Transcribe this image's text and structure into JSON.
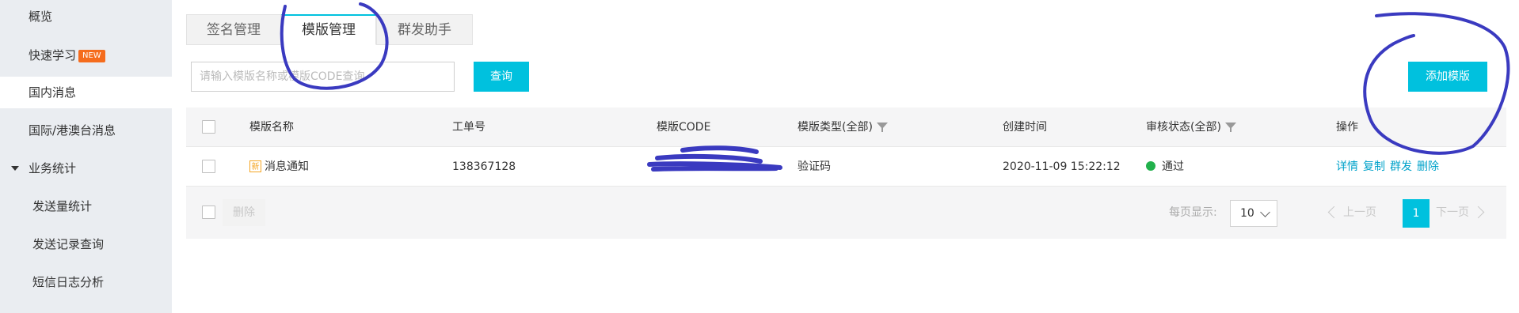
{
  "sidebar": {
    "items": [
      {
        "label": "概览"
      },
      {
        "label": "快速学习",
        "badge": "NEW"
      },
      {
        "label": "国内消息",
        "active": true
      },
      {
        "label": "国际/港澳台消息"
      },
      {
        "label": "业务统计",
        "expanded": true
      },
      {
        "label": "发送量统计"
      },
      {
        "label": "发送记录查询"
      },
      {
        "label": "短信日志分析"
      }
    ]
  },
  "tabs": [
    {
      "label": "签名管理"
    },
    {
      "label": "模版管理",
      "active": true
    },
    {
      "label": "群发助手"
    }
  ],
  "search": {
    "placeholder": "请输入模版名称或模版CODE查询",
    "query_label": "查询"
  },
  "add_template_label": "添加模版",
  "table": {
    "headers": {
      "name": "模版名称",
      "order_no": "工单号",
      "code": "模版CODE",
      "type": "模版类型(全部)",
      "created": "创建时间",
      "status": "审核状态(全部)",
      "ops": "操作"
    },
    "rows": [
      {
        "new_tag": "新",
        "name": "消息通知",
        "order_no": "138367128",
        "code": "",
        "type": "验证码",
        "created": "2020-11-09 15:22:12",
        "status": "通过",
        "ops": [
          "详情",
          "复制",
          "群发",
          "删除"
        ]
      }
    ]
  },
  "footer": {
    "delete_label": "删除",
    "per_page_label": "每页显示:",
    "per_page_value": "10",
    "prev_label": "上一页",
    "next_label": "下一页",
    "current_page": "1"
  },
  "colors": {
    "accent": "#00c1de",
    "sidebar_bg": "#eaedf1",
    "status_ok": "#22b14c",
    "annotation": "#3a3ac0"
  }
}
